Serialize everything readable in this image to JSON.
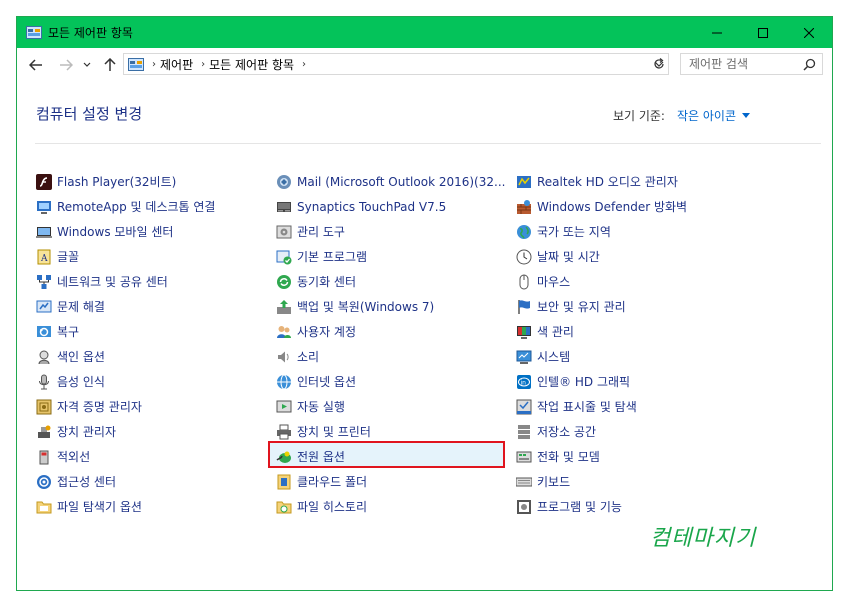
{
  "window": {
    "title": "모든 제어판 항목",
    "title_icon": "control-panel-icon",
    "controls": [
      "minimize-icon",
      "maximize-icon",
      "close-icon"
    ],
    "accent_color": "#04c35a"
  },
  "navbar": {
    "breadcrumb": [
      "제어판",
      "모든 제어판 항목"
    ],
    "search_placeholder": "제어판 검색"
  },
  "header": {
    "title": "컴퓨터 설정 변경",
    "view_by_label": "보기 기준:",
    "view_by_value": "작은 아이콘"
  },
  "columns": [
    [
      {
        "label": "Flash Player(32비트)",
        "icon": "flash-icon"
      },
      {
        "label": "RemoteApp 및 데스크톱 연결",
        "icon": "remoteapp-icon"
      },
      {
        "label": "Windows 모바일 센터",
        "icon": "mobility-icon"
      },
      {
        "label": "글꼴",
        "icon": "font-icon"
      },
      {
        "label": "네트워크 및 공유 센터",
        "icon": "network-icon"
      },
      {
        "label": "문제 해결",
        "icon": "troubleshoot-icon"
      },
      {
        "label": "복구",
        "icon": "recovery-icon"
      },
      {
        "label": "색인 옵션",
        "icon": "indexing-icon"
      },
      {
        "label": "음성 인식",
        "icon": "microphone-icon"
      },
      {
        "label": "자격 증명 관리자",
        "icon": "credential-icon"
      },
      {
        "label": "장치 관리자",
        "icon": "device-manager-icon"
      },
      {
        "label": "적외선",
        "icon": "infrared-icon"
      },
      {
        "label": "접근성 센터",
        "icon": "accessibility-icon"
      },
      {
        "label": "파일 탐색기 옵션",
        "icon": "folder-options-icon"
      }
    ],
    [
      {
        "label": "Mail (Microsoft Outlook 2016)(32...",
        "icon": "mail-icon"
      },
      {
        "label": "Synaptics TouchPad V7.5",
        "icon": "touchpad-icon"
      },
      {
        "label": "관리 도구",
        "icon": "admin-tools-icon"
      },
      {
        "label": "기본 프로그램",
        "icon": "default-programs-icon"
      },
      {
        "label": "동기화 센터",
        "icon": "sync-icon"
      },
      {
        "label": "백업 및 복원(Windows 7)",
        "icon": "backup-icon"
      },
      {
        "label": "사용자 계정",
        "icon": "user-accounts-icon"
      },
      {
        "label": "소리",
        "icon": "sound-icon"
      },
      {
        "label": "인터넷 옵션",
        "icon": "internet-options-icon"
      },
      {
        "label": "자동 실행",
        "icon": "autoplay-icon"
      },
      {
        "label": "장치 및 프린터",
        "icon": "printer-icon"
      },
      {
        "label": "전원 옵션",
        "icon": "power-options-icon"
      },
      {
        "label": "클라우드 폴더",
        "icon": "cloud-folder-icon"
      },
      {
        "label": "파일 히스토리",
        "icon": "file-history-icon"
      }
    ],
    [
      {
        "label": "Realtek HD 오디오 관리자",
        "icon": "realtek-icon"
      },
      {
        "label": "Windows Defender 방화벽",
        "icon": "firewall-icon"
      },
      {
        "label": "국가 또는 지역",
        "icon": "region-icon"
      },
      {
        "label": "날짜 및 시간",
        "icon": "clock-icon"
      },
      {
        "label": "마우스",
        "icon": "mouse-icon"
      },
      {
        "label": "보안 및 유지 관리",
        "icon": "security-flag-icon"
      },
      {
        "label": "색 관리",
        "icon": "color-management-icon"
      },
      {
        "label": "시스템",
        "icon": "system-icon"
      },
      {
        "label": "인텔® HD 그래픽",
        "icon": "intel-graphics-icon"
      },
      {
        "label": "작업 표시줄 및 탐색",
        "icon": "taskbar-icon"
      },
      {
        "label": "저장소 공간",
        "icon": "storage-icon"
      },
      {
        "label": "전화 및 모뎀",
        "icon": "modem-icon"
      },
      {
        "label": "키보드",
        "icon": "keyboard-icon"
      },
      {
        "label": "프로그램 및 기능",
        "icon": "programs-icon"
      }
    ]
  ],
  "highlighted_item": "전원 옵션",
  "highlight_color": "#e0141e",
  "watermark": "컴테마지기"
}
